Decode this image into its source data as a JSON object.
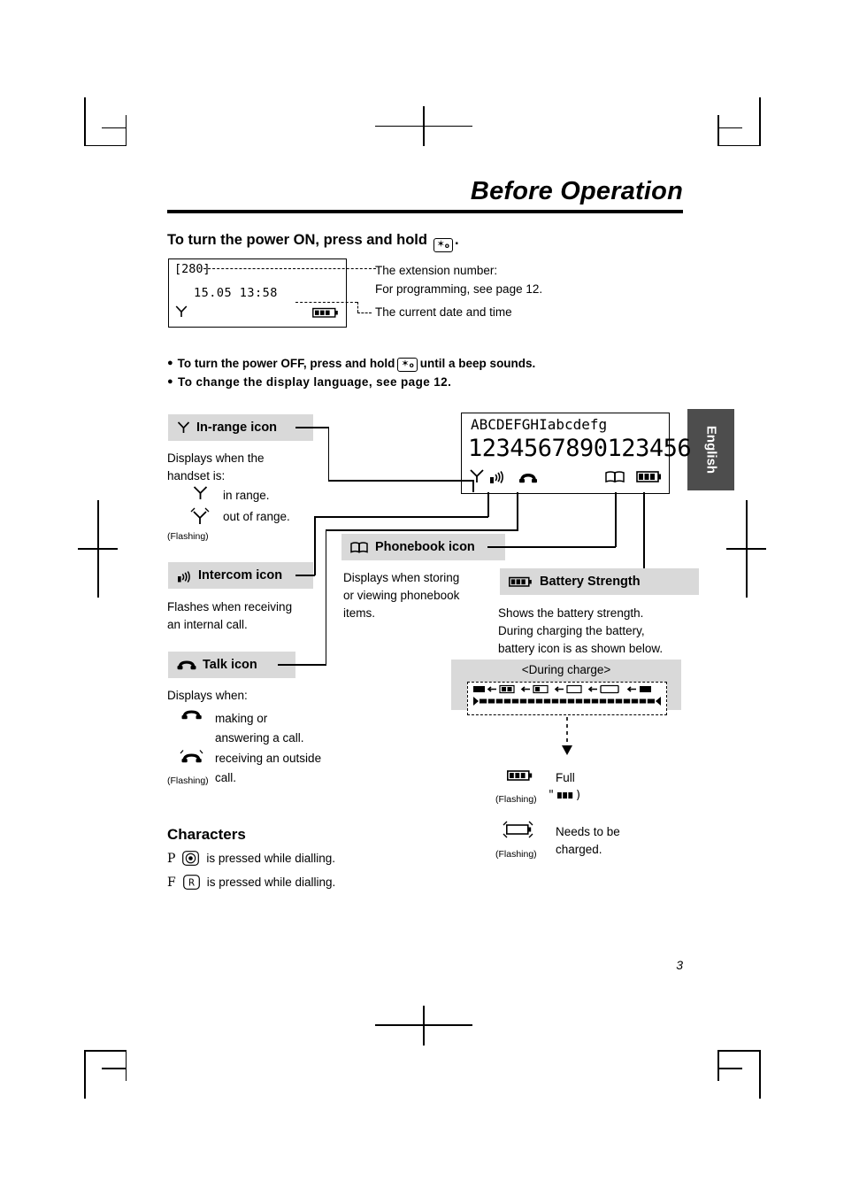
{
  "document": {
    "title": "Before Operation",
    "page_number": "3",
    "side_tab": "English"
  },
  "power_on": {
    "heading_before": "To turn the power ON, press and hold",
    "heading_after": ".",
    "key_icon": "power-key-icon",
    "lcd": {
      "line1": "[280]",
      "line2": "15.05 13:58",
      "antenna_icon": "in-range-icon",
      "battery_icon": "battery-full-icon"
    },
    "callout_extension_1": "The extension number:",
    "callout_extension_2": "For programming, see page 12.",
    "callout_datetime": "The current date and time"
  },
  "bullets": [
    {
      "before": "To turn the power OFF, press and hold",
      "after": "until a beep sounds."
    },
    {
      "text": "To change the display language, see page 12."
    }
  ],
  "display_sample": {
    "row1": "ABCDEFGHIabcdefg",
    "row2": "1234567890123456",
    "icons": [
      "in-range-icon",
      "intercom-icon",
      "talk-icon",
      "phonebook-icon",
      "battery-icon"
    ]
  },
  "legend": {
    "in_range": {
      "label": "In-range icon",
      "icon": "antenna-icon",
      "text1": "Displays when the",
      "text2": "handset is:",
      "item1": "in range.",
      "item2": "out of range.",
      "flashing": "(Flashing)"
    },
    "intercom": {
      "label": "Intercom icon",
      "icon": "intercom-icon",
      "text1": "Flashes when receiving",
      "text2": "an internal call."
    },
    "talk": {
      "label": "Talk icon",
      "icon": "talk-icon",
      "text1": "Displays when:",
      "item1a": "making or",
      "item1b": "answering a call.",
      "item2": "receiving an outside",
      "flashing": "(Flashing)",
      "item2b": "call."
    },
    "phonebook": {
      "label": "Phonebook icon",
      "icon": "phonebook-icon",
      "text1": "Displays when storing",
      "text2": "or viewing phonebook",
      "text3": "items."
    },
    "battery": {
      "label": "Battery Strength",
      "icon": "battery-icon",
      "text1": "Shows the battery strength.",
      "text2": "During charging the battery,",
      "text3": "battery icon is as shown below.",
      "charge_title": "<During charge>",
      "full_label": "Full",
      "full_flashing": "(Flashing)",
      "needs_label1": "Needs to be",
      "needs_label2": "charged.",
      "needs_flashing": "(Flashing)"
    }
  },
  "characters": {
    "heading": "Characters",
    "rows": [
      {
        "letter": "P",
        "key": "©",
        "key_name": "pause-key-icon",
        "text": "is pressed while dialling."
      },
      {
        "letter": "F",
        "key": "R",
        "key_name": "recall-key-icon",
        "text": "is pressed while dialling."
      }
    ]
  },
  "colors": {
    "label_bg": "#d9d9d9",
    "tab_bg": "#4d4d4d",
    "ink": "#000000"
  }
}
